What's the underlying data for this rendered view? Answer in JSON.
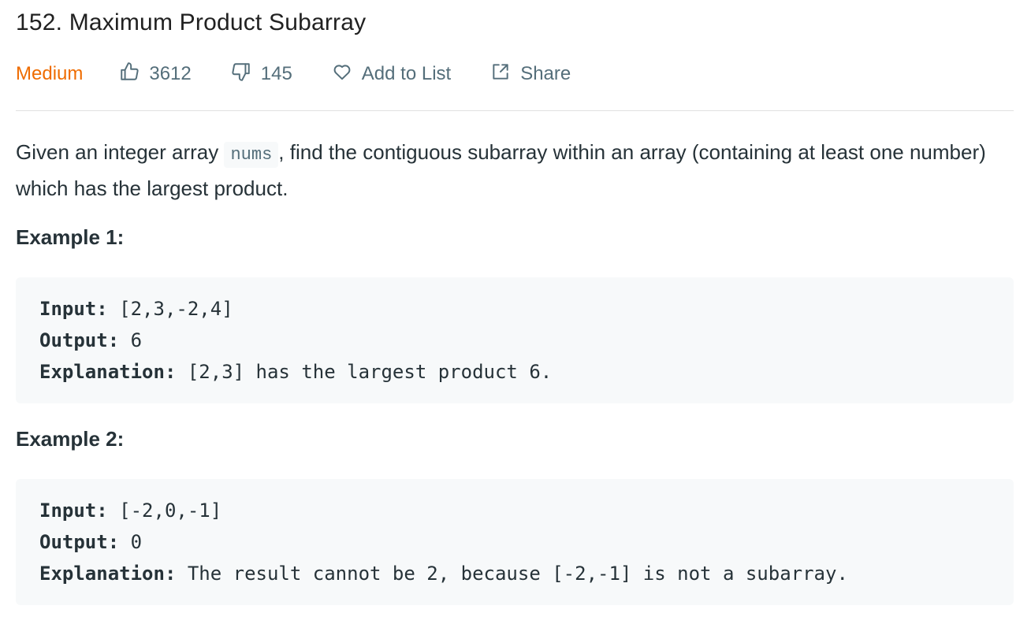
{
  "problem": {
    "title": "152. Maximum Product Subarray",
    "difficulty": "Medium",
    "likes": "3612",
    "dislikes": "145",
    "add_to_list_label": "Add to List",
    "share_label": "Share"
  },
  "colors": {
    "difficulty_medium": "#ef6c00",
    "meta_text": "#546e7a",
    "code_background": "#f7f9fa",
    "divider": "#e0e0e0"
  },
  "description": {
    "before_code": "Given an integer array ",
    "code": "nums",
    "after_code": ", find the contiguous subarray within an array (containing at least one number) which has the largest product."
  },
  "examples": [
    {
      "heading": "Example 1:",
      "input_label": "Input:",
      "input_value": " [2,3,-2,4]",
      "output_label": "Output:",
      "output_value": " 6",
      "explanation_label": "Explanation:",
      "explanation_value": " [2,3] has the largest product 6."
    },
    {
      "heading": "Example 2:",
      "input_label": "Input:",
      "input_value": " [-2,0,-1]",
      "output_label": "Output:",
      "output_value": " 0",
      "explanation_label": "Explanation:",
      "explanation_value": " The result cannot be 2, because [-2,-1] is not a subarray."
    }
  ],
  "icons": {
    "like": "thumbs-up-icon",
    "dislike": "thumbs-down-icon",
    "favorite": "heart-icon",
    "share": "share-icon"
  }
}
